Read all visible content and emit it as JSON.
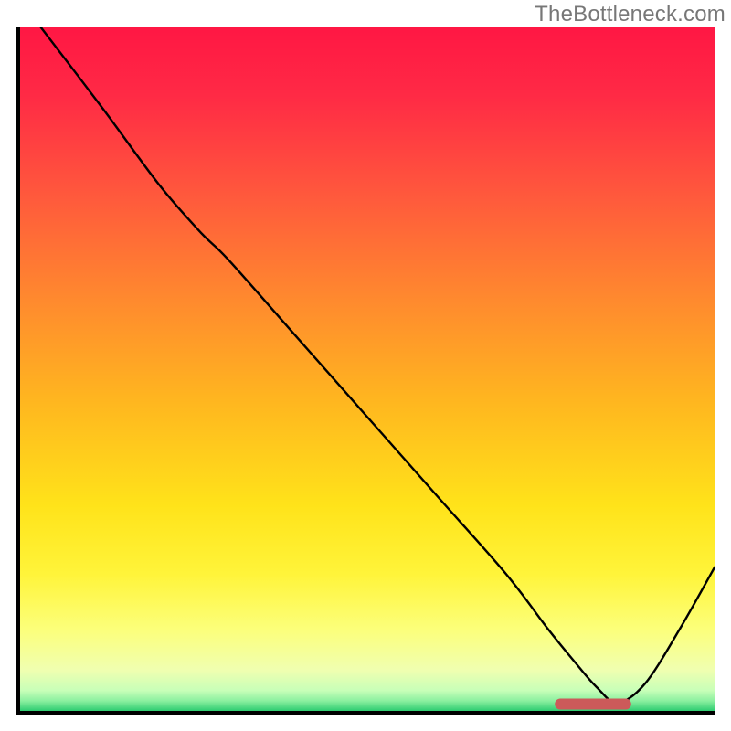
{
  "watermark": "TheBottleneck.com",
  "chart_data": {
    "type": "line",
    "title": "",
    "xlabel": "",
    "ylabel": "",
    "xlim": [
      0,
      100
    ],
    "ylim": [
      0,
      100
    ],
    "background_gradient": {
      "stops": [
        {
          "offset": 0.0,
          "color": "#ff1744"
        },
        {
          "offset": 0.1,
          "color": "#ff2a45"
        },
        {
          "offset": 0.25,
          "color": "#ff5a3c"
        },
        {
          "offset": 0.4,
          "color": "#ff8a2e"
        },
        {
          "offset": 0.55,
          "color": "#ffb71f"
        },
        {
          "offset": 0.7,
          "color": "#ffe31a"
        },
        {
          "offset": 0.8,
          "color": "#fff43a"
        },
        {
          "offset": 0.88,
          "color": "#fcff7a"
        },
        {
          "offset": 0.94,
          "color": "#f0ffb0"
        },
        {
          "offset": 0.97,
          "color": "#c8ffb8"
        },
        {
          "offset": 0.985,
          "color": "#8cf0a0"
        },
        {
          "offset": 1.0,
          "color": "#2ecc71"
        }
      ]
    },
    "series": [
      {
        "name": "bottleneck-curve",
        "color": "#000000",
        "width": 2.4,
        "x": [
          3,
          12,
          20,
          26,
          30,
          40,
          50,
          60,
          70,
          76,
          80,
          83,
          86,
          90,
          95,
          100
        ],
        "y": [
          100,
          88,
          77,
          70,
          66,
          54.5,
          43,
          31.5,
          20,
          12,
          7,
          3.5,
          1.2,
          4,
          12,
          21
        ]
      }
    ],
    "marker": {
      "name": "optimal-range",
      "color": "#cc5a5a",
      "x_start": 77,
      "x_end": 88,
      "y": 1.0,
      "thickness": 12,
      "radius": 6
    }
  }
}
